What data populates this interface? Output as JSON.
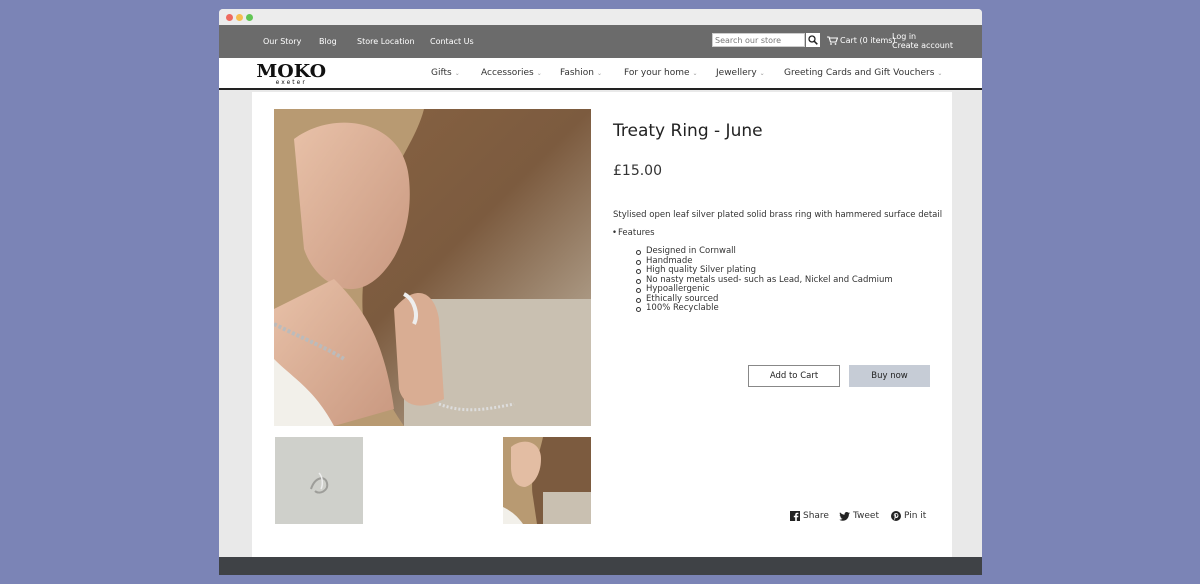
{
  "topbar": {
    "links": [
      "Our Story",
      "Blog",
      "Store Location",
      "Contact Us"
    ],
    "search_placeholder": "Search our store",
    "cart_label": "Cart (0 items)",
    "login_label": "Log in",
    "create_account_label": "Create account"
  },
  "logo": {
    "main": "MOKO",
    "sub": "exeter"
  },
  "nav": {
    "items": [
      "Gifts",
      "Accessories",
      "Fashion",
      "For your home",
      "Jewellery",
      "Greeting Cards and Gift Vouchers"
    ]
  },
  "product": {
    "title": "Treaty Ring - June",
    "price": "£15.00",
    "description": "Stylised open leaf silver plated solid brass ring with hammered surface detail",
    "features_heading": "Features",
    "features": [
      "Designed in Cornwall",
      "Handmade",
      "High quality Silver plating",
      "No nasty metals used- such as Lead, Nickel and Cadmium",
      "Hypoallergenic",
      "Ethically sourced",
      "100% Recyclable"
    ],
    "add_to_cart_label": "Add to Cart",
    "buy_now_label": "Buy now"
  },
  "social": {
    "share": "Share",
    "tweet": "Tweet",
    "pin": "Pin it"
  },
  "colors": {
    "background": "#7b84b6",
    "topbar": "#6b6b6b",
    "footer": "#3f4246",
    "buy_button": "#c6ccd6"
  }
}
